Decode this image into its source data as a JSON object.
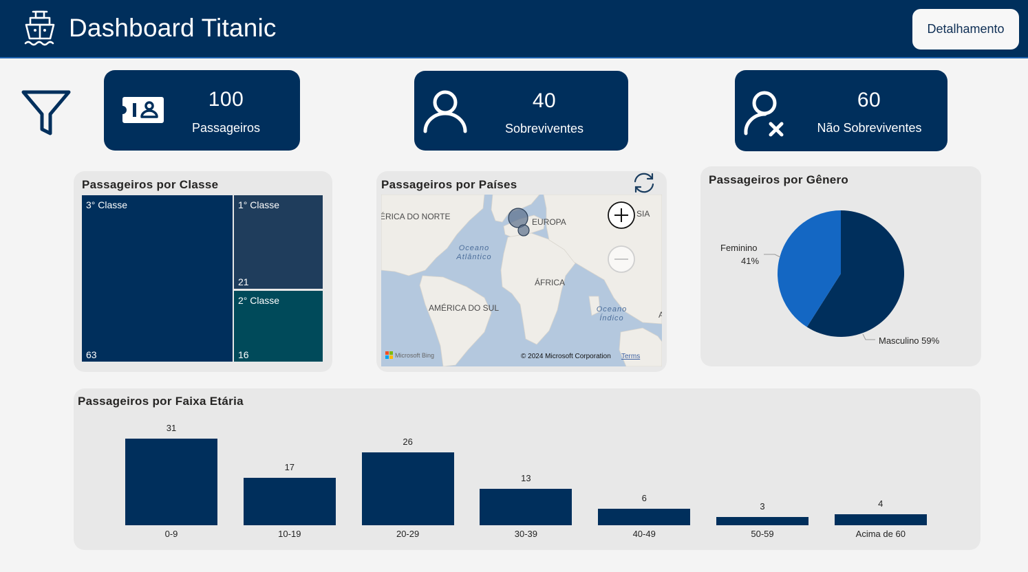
{
  "header": {
    "title": "Dashboard Titanic",
    "detail_button": "Detalhamento",
    "bg_color": "#002f5c"
  },
  "kpis": [
    {
      "value": "100",
      "label": "Passageiros",
      "icon": "id-card-icon"
    },
    {
      "value": "40",
      "label": "Sobreviventes",
      "icon": "user-icon"
    },
    {
      "value": "60",
      "label": "Não Sobreviventes",
      "icon": "user-x-icon"
    }
  ],
  "treemap": {
    "title": "Passageiros por Classe",
    "items": [
      {
        "label": "3° Classe",
        "value": "63",
        "color": "#002f5c"
      },
      {
        "label": "1° Classe",
        "value": "21",
        "color": "#1f3d5c"
      },
      {
        "label": "2° Classe",
        "value": "16",
        "color": "#004a5a"
      }
    ]
  },
  "map": {
    "title": "Passageiros por Países",
    "labels": {
      "north_america": "ÉRICA DO NORTE",
      "europe": "EUROPA",
      "asia": "SIA",
      "atlantic": "Oceano Atlântico",
      "africa": "ÁFRICA",
      "south_america": "AMÉRICA DO SUL",
      "indian": "Oceano Índico",
      "edge": "A"
    },
    "provider": "Microsoft Bing",
    "copyright": "© 2024 Microsoft Corporation",
    "terms": "Terms"
  },
  "pie": {
    "title": "Passageiros por Gênero",
    "female_label": "Feminino",
    "female_pct": "41%",
    "male_label": "Masculino 59%"
  },
  "bars": {
    "title": "Passageiros por Faixa Etária"
  },
  "chart_data": [
    {
      "type": "pie",
      "title": "Passageiros por Gênero",
      "categories": [
        "Feminino",
        "Masculino"
      ],
      "values": [
        41,
        59
      ],
      "colors": [
        "#1467c3",
        "#002f5c"
      ]
    },
    {
      "type": "bar",
      "title": "Passageiros por Faixa Etária",
      "categories": [
        "0-9",
        "10-19",
        "20-29",
        "30-39",
        "40-49",
        "50-59",
        "Acima de 60"
      ],
      "values": [
        31,
        17,
        26,
        13,
        6,
        3,
        4
      ],
      "color": "#002f5c"
    }
  ]
}
